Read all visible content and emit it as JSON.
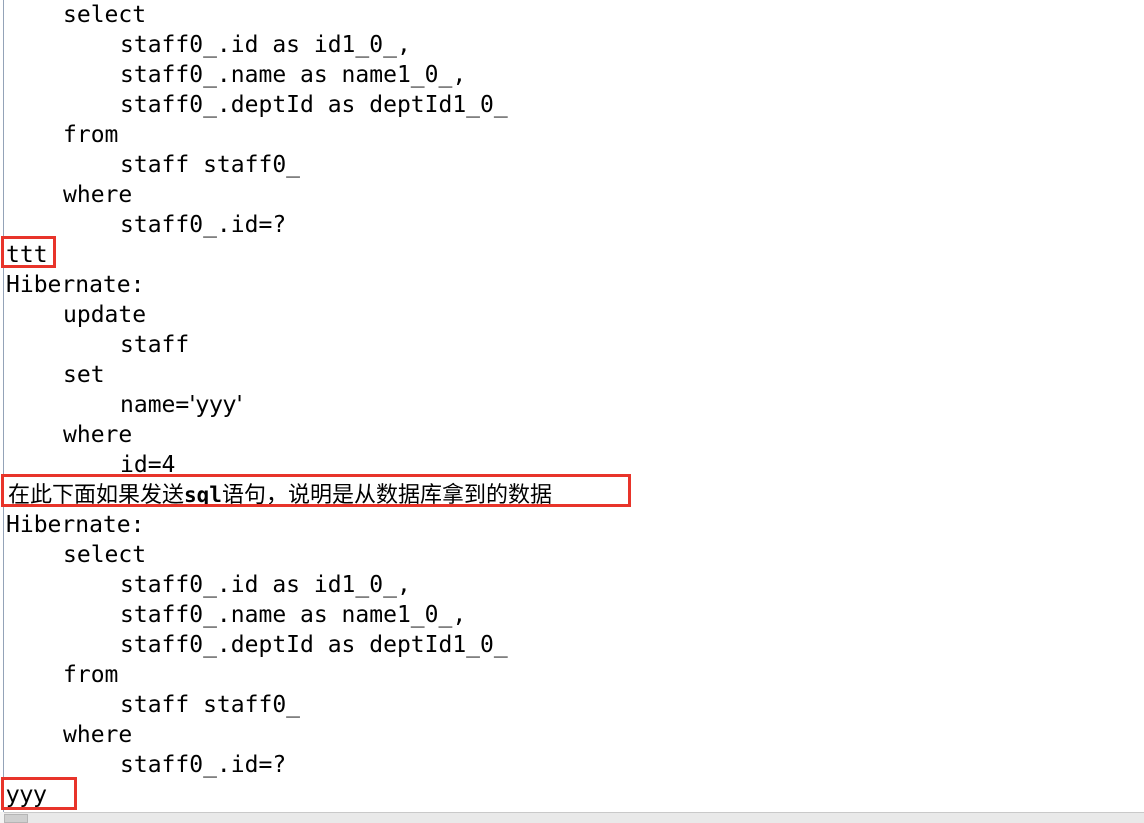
{
  "console": {
    "lines": [
      {
        "indent": 1,
        "text": "select"
      },
      {
        "indent": 2,
        "text": "staff0_.id as id1_0_,"
      },
      {
        "indent": 2,
        "text": "staff0_.name as name1_0_,"
      },
      {
        "indent": 2,
        "text": "staff0_.deptId as deptId1_0_"
      },
      {
        "indent": 1,
        "text": "from"
      },
      {
        "indent": 2,
        "text": "staff staff0_"
      },
      {
        "indent": 1,
        "text": "where"
      },
      {
        "indent": 2,
        "text": "staff0_.id=?"
      }
    ],
    "echo_ttt": "ttt",
    "hibernate_label_1": "Hibernate:",
    "update_block": [
      {
        "indent": 1,
        "text": "update"
      },
      {
        "indent": 2,
        "text": "staff"
      },
      {
        "indent": 1,
        "text": "set"
      }
    ],
    "set_value_line": {
      "indent": 2,
      "prefix": "name=",
      "quote_open": "'",
      "value": "yyy",
      "quote_close": "'"
    },
    "update_where_block": [
      {
        "indent": 1,
        "text": "where"
      },
      {
        "indent": 2,
        "text": "id=4"
      }
    ],
    "annotation_note": {
      "part_1": "在此下面如果发送",
      "part_mono": "sql",
      "part_2": "语句，说明是从数据库拿到的数据"
    },
    "hibernate_label_2": "Hibernate:",
    "lines_2": [
      {
        "indent": 1,
        "text": "select"
      },
      {
        "indent": 2,
        "text": "staff0_.id as id1_0_,"
      },
      {
        "indent": 2,
        "text": "staff0_.name as name1_0_,"
      },
      {
        "indent": 2,
        "text": "staff0_.deptId as deptId1_0_"
      },
      {
        "indent": 1,
        "text": "from"
      },
      {
        "indent": 2,
        "text": "staff staff0_"
      },
      {
        "indent": 1,
        "text": "where"
      },
      {
        "indent": 2,
        "text": "staff0_.id=?"
      }
    ],
    "echo_yyy": "yyy"
  },
  "annotations": {
    "box_ttt_label": "ttt",
    "box_note_label": "在此下面如果发送sql语句，说明是从数据库拿到的数据",
    "box_yyy_label": "yyy",
    "box_color": "#e8342a"
  },
  "colors": {
    "background": "#ffffff",
    "text": "#000000",
    "gutter_rule": "#94a3b8",
    "annotation_red": "#e8342a",
    "scrollbar_track": "#e9e9e9",
    "scrollbar_thumb": "#cfcfcf"
  }
}
